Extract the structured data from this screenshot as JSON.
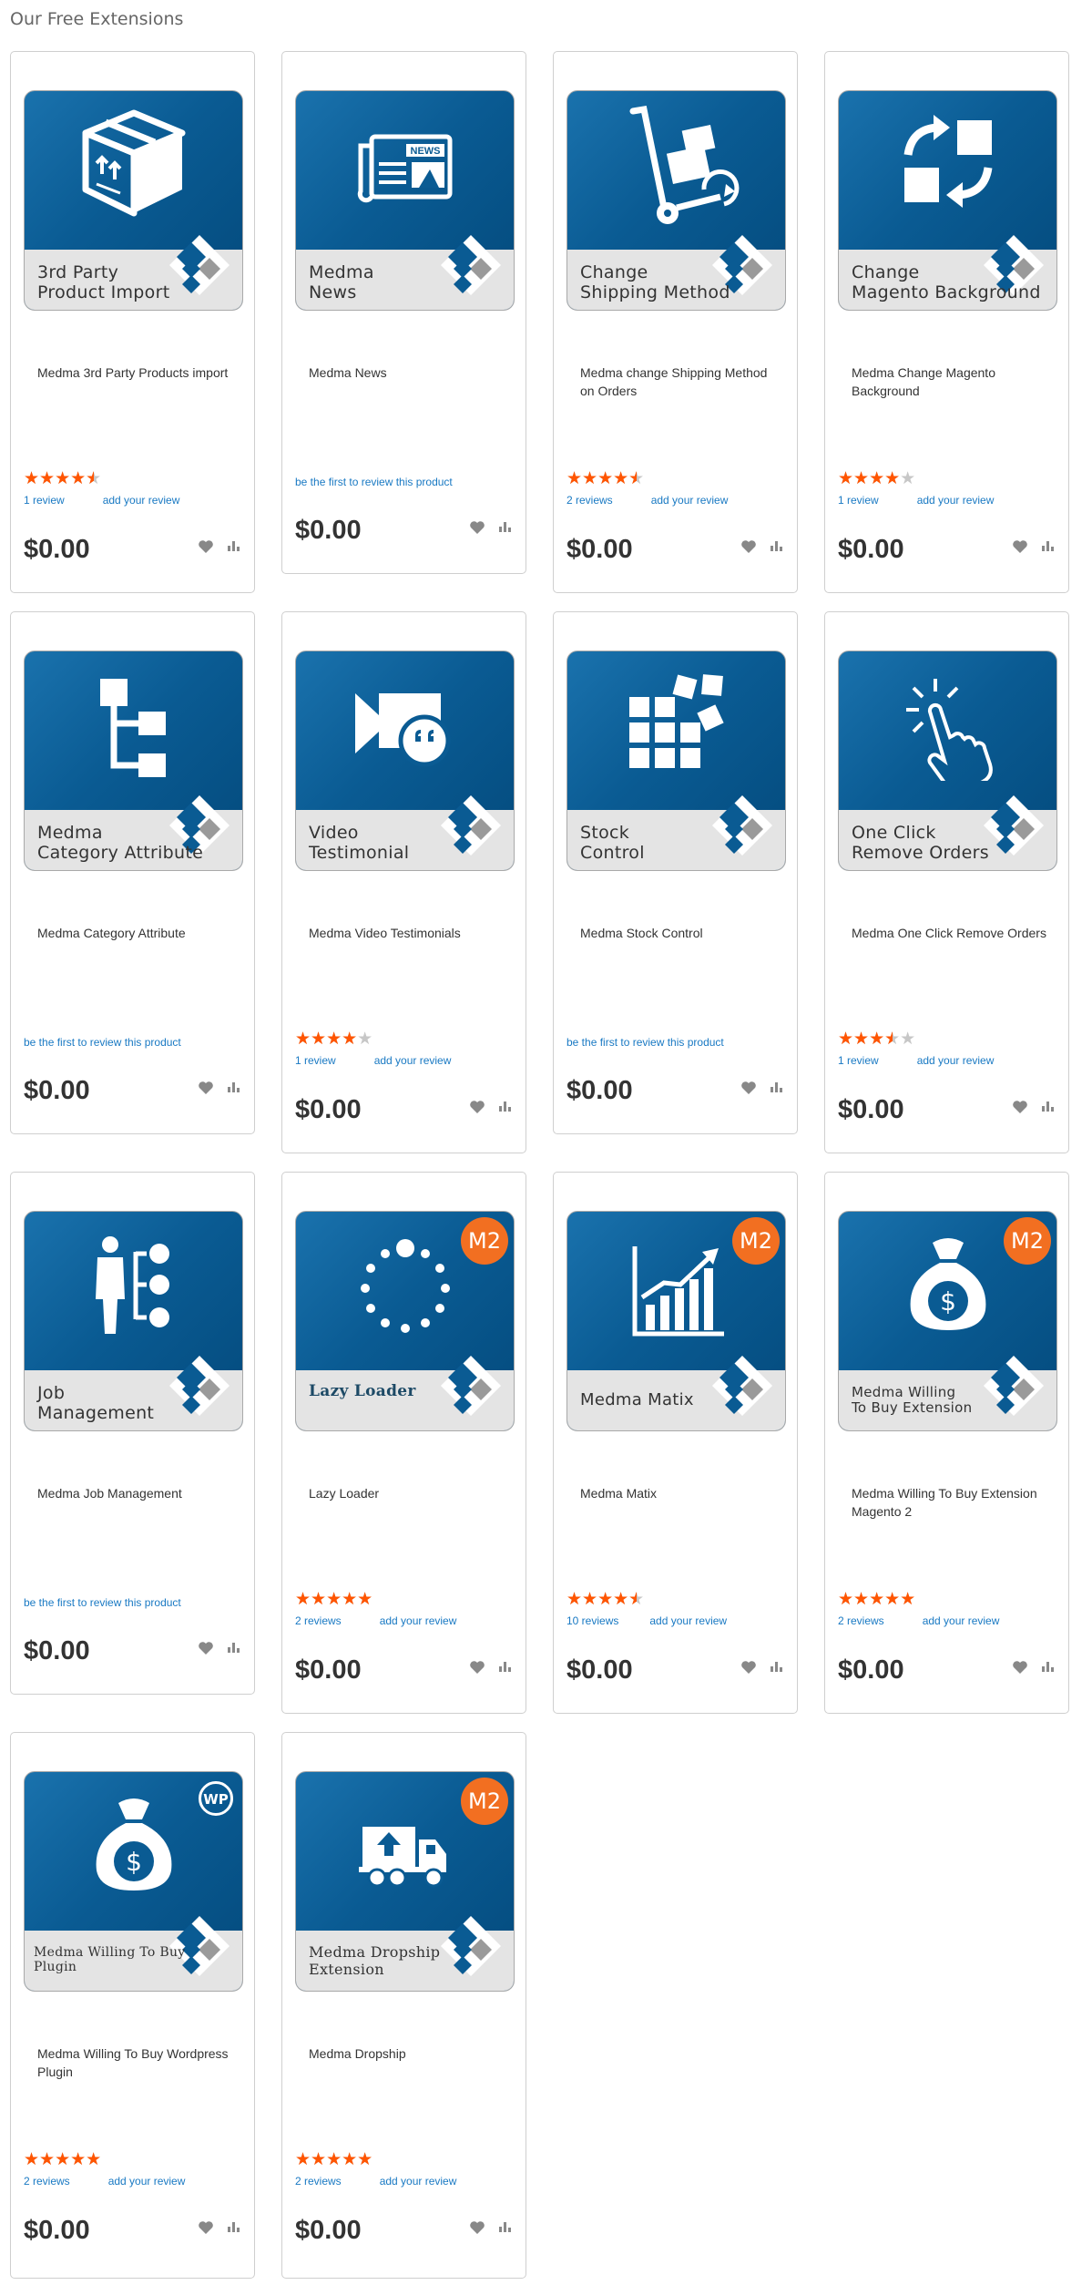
{
  "page": {
    "title": "Our Free Extensions"
  },
  "colors": {
    "accent": "#1979c3",
    "star": "#ff5501",
    "tile": "#0a5b93",
    "badge": "#f26f21"
  },
  "products": [
    {
      "thumb_label": "3rd Party\nProduct Import",
      "name": "Medma 3rd Party Products import",
      "icon": "box-icon",
      "rating_percent": 90,
      "reviews": "1 review",
      "add_review": "add your review",
      "price": "$0.00"
    },
    {
      "thumb_label": "Medma\nNews",
      "name": "Medma News",
      "icon": "newspaper-icon",
      "first_review": "be the first to review this product",
      "price": "$0.00",
      "icon_text": "NEWS"
    },
    {
      "thumb_label": "Change\nShipping Method",
      "name": "Medma change Shipping Method on Orders",
      "icon": "hand-truck-icon",
      "rating_percent": 90,
      "reviews": "2 reviews",
      "add_review": "add your review",
      "price": "$0.00"
    },
    {
      "thumb_label": "Change\nMagento Background",
      "name": "Medma Change Magento Background",
      "icon": "swap-squares-icon",
      "rating_percent": 80,
      "reviews": "1 review",
      "add_review": "add your review",
      "price": "$0.00"
    },
    {
      "thumb_label": "Medma\nCategory Attribute",
      "name": "Medma Category Attribute",
      "icon": "tree-icon",
      "first_review": "be the first to review this product",
      "price": "$0.00"
    },
    {
      "thumb_label": "Video\nTestimonial",
      "name": "Medma Video Testimonials",
      "icon": "video-camera-icon",
      "rating_percent": 80,
      "reviews": "1 review",
      "add_review": "add your review",
      "price": "$0.00"
    },
    {
      "thumb_label": "Stock\nControl",
      "name": "Medma Stock Control",
      "icon": "blocks-icon",
      "first_review": "be the first to review this product",
      "price": "$0.00"
    },
    {
      "thumb_label": "One Click\nRemove Orders",
      "name": "Medma One Click Remove Orders",
      "icon": "click-hand-icon",
      "rating_percent": 70,
      "reviews": "1 review",
      "add_review": "add your review",
      "price": "$0.00"
    },
    {
      "thumb_label": "Job\nManagement",
      "name": "Medma Job Management",
      "icon": "person-hierarchy-icon",
      "first_review": "be the first to review this product",
      "price": "$0.00"
    },
    {
      "thumb_label": "Lazy Loader",
      "name": "Lazy Loader",
      "icon": "loader-dots-icon",
      "badge": "M2",
      "rating_percent": 100,
      "reviews": "2 reviews",
      "add_review": "add your review",
      "price": "$0.00"
    },
    {
      "thumb_label": "Medma Matix",
      "name": "Medma Matix",
      "icon": "bar-chart-icon",
      "badge": "M2",
      "rating_percent": 90,
      "reviews": "10 reviews",
      "add_review": "add your review",
      "price": "$0.00"
    },
    {
      "thumb_label": "Medma Willing\nTo Buy Extension",
      "name": "Medma Willing To Buy Extension Magento 2",
      "icon": "money-bag-icon",
      "badge": "M2",
      "rating_percent": 100,
      "reviews": "2 reviews",
      "add_review": "add your review",
      "price": "$0.00"
    },
    {
      "thumb_label": "Medma Willing To Buy\nPlugin",
      "name": "Medma Willing To Buy Wordpress Plugin",
      "icon": "money-bag-icon",
      "badge": "WP",
      "rating_percent": 100,
      "reviews": "2 reviews",
      "add_review": "add your review",
      "price": "$0.00"
    },
    {
      "thumb_label": "Medma Dropship\nExtension",
      "name": "Medma Dropship",
      "icon": "truck-icon",
      "badge": "M2",
      "rating_percent": 100,
      "reviews": "2 reviews",
      "add_review": "add your review",
      "price": "$0.00"
    }
  ]
}
